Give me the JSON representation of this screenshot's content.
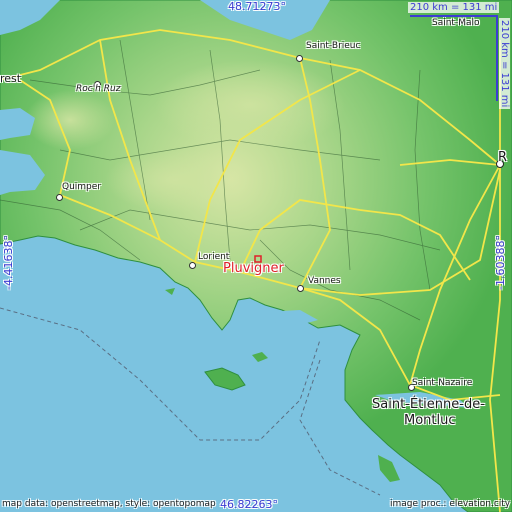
{
  "map": {
    "top_lat": "48.71273°",
    "bottom_lat": "46.82263°",
    "left_lon": "-4.41638°",
    "right_lon": "-1.60388°",
    "scale_h": "210 km = 131 mi",
    "scale_v": "210 km = 131 mi",
    "credit_left": "map data: openstreetmap, style: opentopomap",
    "credit_right": "image proc.: elevation.city",
    "highlight": "Pluvigner",
    "places": {
      "brest": "rest",
      "saint_brieuc": "Saint-Brieuc",
      "saint_malo": "Saint-Malo",
      "roch_ruz": "Roc'h Ruz",
      "quimper": "Quimper",
      "lorient": "Lorient",
      "vannes": "Vannes",
      "rennes": "R",
      "saint_nazaire": "Saint-Nazaire",
      "saint_etienne_1": "Saint-Étienne-de-",
      "saint_etienne_2": "Montluc"
    },
    "colors": {
      "sea": "#7cc3e0",
      "land_low": "#4fb04f",
      "land_high": "#d8e6a6",
      "roads": "#f2e64a",
      "marker": "#e0202a",
      "coords": "#3c3cd2"
    }
  }
}
